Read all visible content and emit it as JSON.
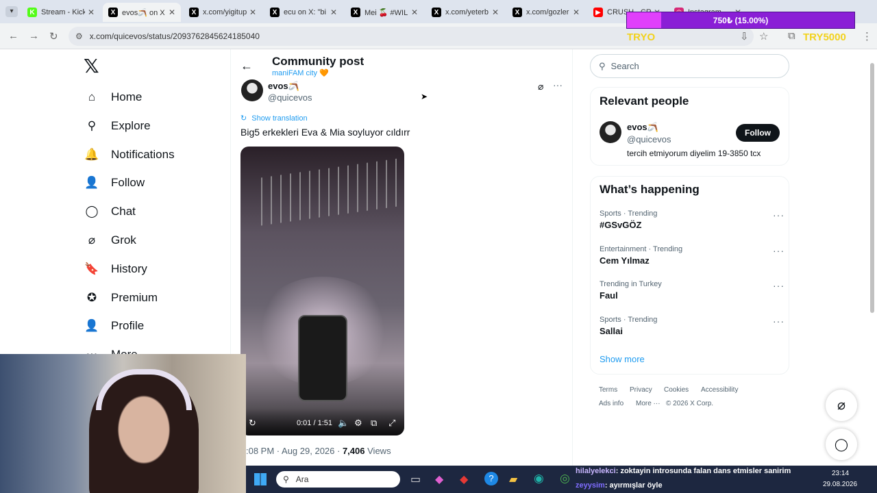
{
  "browser": {
    "tabs": [
      {
        "title": "Stream - Kick",
        "fav": "K",
        "color": "#53fc18"
      },
      {
        "title": "evos🪃 on X",
        "fav": "X",
        "color": "#000000",
        "active": true
      },
      {
        "title": "x.com/yigitup",
        "fav": "X",
        "color": "#000000"
      },
      {
        "title": "ecu on X: \"bi",
        "fav": "X",
        "color": "#000000"
      },
      {
        "title": "Mei 🍒 #WIL",
        "fav": "X",
        "color": "#000000"
      },
      {
        "title": "x.com/yeterb",
        "fav": "X",
        "color": "#000000"
      },
      {
        "title": "x.com/gozler",
        "fav": "X",
        "color": "#000000"
      },
      {
        "title": "CRUSH - CR",
        "fav": "▶",
        "color": "#ff0000"
      },
      {
        "title": "Instagram",
        "fav": "◎",
        "color": "#d62976"
      }
    ],
    "url": "x.com/quicevos/status/2093762845624185040"
  },
  "overlay": {
    "donation": "750₺ (15.00%)",
    "tryo": "TRYO",
    "try5000": "TRY5000"
  },
  "sidebar": {
    "logo": "𝕏",
    "items": [
      {
        "label": "Home",
        "icon": "home-icon"
      },
      {
        "label": "Explore",
        "icon": "search-icon"
      },
      {
        "label": "Notifications",
        "icon": "bell-icon"
      },
      {
        "label": "Follow",
        "icon": "person-plus-icon"
      },
      {
        "label": "Chat",
        "icon": "chat-icon"
      },
      {
        "label": "Grok",
        "icon": "grok-icon"
      },
      {
        "label": "History",
        "icon": "bookmark-icon"
      },
      {
        "label": "Premium",
        "icon": "premium-icon"
      },
      {
        "label": "Profile",
        "icon": "person-icon"
      },
      {
        "label": "More",
        "icon": "more-icon"
      }
    ]
  },
  "post": {
    "header_title": "Community post",
    "community": "maniFAM city 🧡",
    "author_name": "evos🪃",
    "author_handle": "@quicevos",
    "show_translation": "Show translation",
    "text": "Big5 erkekleri Eva & Mia soyluyor cıldırr",
    "video_time": "0:01 / 1:51",
    "meta_time": ":08 PM",
    "meta_date": "Aug 29, 2026",
    "views_count": "7,406",
    "views_label": "Views"
  },
  "right": {
    "search_placeholder": "Search",
    "relevant_title": "Relevant people",
    "person_name": "evos🪃",
    "person_handle": "@quicevos",
    "person_bio": "tercih etmiyorum diyelim 19-3850 tcx",
    "follow_label": "Follow",
    "happening_title": "What’s happening",
    "trends": [
      {
        "category": "Sports · Trending",
        "name": "#GSvGÖZ"
      },
      {
        "category": "Entertainment · Trending",
        "name": "Cem Yılmaz"
      },
      {
        "category": "Trending in Turkey",
        "name": "Faul"
      },
      {
        "category": "Sports · Trending",
        "name": "Sallai"
      }
    ],
    "show_more": "Show more",
    "footer": [
      "Terms",
      "Privacy",
      "Cookies",
      "Accessibility",
      "Ads info",
      "More ···",
      "© 2026 X Corp."
    ]
  },
  "chat": [
    {
      "user": "hilalyelekci",
      "msg": ": zoktayin introsunda falan dans etmisler sanirim"
    },
    {
      "user": "zeyysim",
      "msg": ": ayırmışlar öyle"
    }
  ],
  "taskbar": {
    "search": "Ara",
    "time": "23:14",
    "date": "29.08.2026"
  }
}
